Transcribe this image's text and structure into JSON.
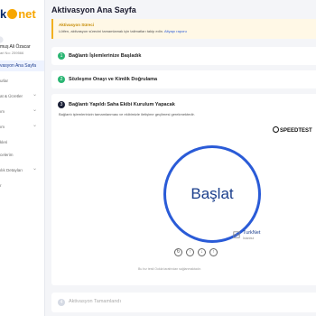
{
  "brand": {
    "logo_prefix": "k",
    "logo_suffix": "net"
  },
  "user": {
    "name": "muş Ali Özacar",
    "subtitle": "ari No: 259566"
  },
  "sidebar": {
    "active_label": "vasyon Ana Sayfa",
    "items": [
      {
        "label": "urlar"
      },
      {
        "label": "at & Ücretler"
      },
      {
        "label": "ım"
      },
      {
        "label": "ım"
      },
      {
        "label": "kleri"
      },
      {
        "label": "celerim"
      },
      {
        "label": "ılık Detayları"
      },
      {
        "label": "r"
      }
    ]
  },
  "page": {
    "title": "Aktivasyon Ana Sayfa"
  },
  "notice": {
    "title": "Aktivasyon Süreci",
    "text": "Lütfen, aktivasyon sürecini tamamlamak için talimatları takip edin.",
    "link": "Altyapı raporu"
  },
  "steps": [
    {
      "number": "1",
      "title": "Bağlantı İşlemlerinize Başladık"
    },
    {
      "number": "2",
      "title": "Sözleşme Onayı ve Kimlik Doğrulama"
    },
    {
      "number": "3",
      "title": "Bağlantı Yapıldı Saha Ekibi Kurulum Yapacak",
      "description": "Bağlantı işlemlerinizin tamamlanması ve ekibimizle iletişime geçilmesi gerekmektedir."
    },
    {
      "number": "4",
      "title": "Aktivasyon Tamamlandı"
    }
  ],
  "speedtest": {
    "brand": "SPEEDTEST",
    "start_label": "Başlat",
    "isp_name": "TurkNet",
    "isp_location": "İstanbul",
    "buttons": [
      "↻",
      "↑",
      "↓",
      "↑"
    ],
    "footnote": "Bu hız testi Ookla tarafından sağlanmaktadır."
  },
  "colors": {
    "accent": "#2a5bd7",
    "brand_orange": "#f7a600",
    "success": "#2bb673"
  }
}
